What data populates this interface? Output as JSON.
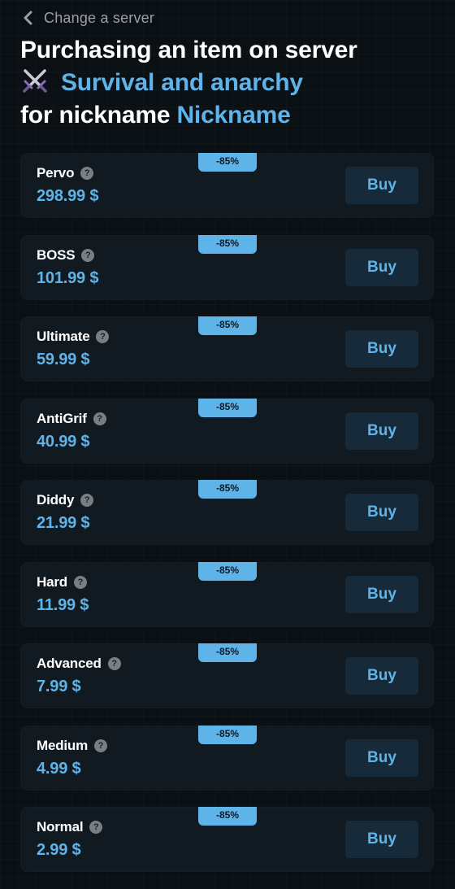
{
  "header": {
    "back_label": "Change a server",
    "title_line1": "Purchasing an item on server",
    "server_name": "Survival and anarchy",
    "server_icon": "crossed-swords-icon",
    "nickname_prefix": "for nickname",
    "nickname": "Nickname"
  },
  "colors": {
    "accent": "#5eb3e8",
    "background": "#0b1015",
    "card": "#111a21",
    "buy_button": "#172a3a"
  },
  "products": [
    {
      "name": "Pervo",
      "price": "298.99 $",
      "discount": "-85%",
      "buy_label": "Buy",
      "help": "?"
    },
    {
      "name": "BOSS",
      "price": "101.99 $",
      "discount": "-85%",
      "buy_label": "Buy",
      "help": "?"
    },
    {
      "name": "Ultimate",
      "price": "59.99 $",
      "discount": "-85%",
      "buy_label": "Buy",
      "help": "?"
    },
    {
      "name": "AntiGrif",
      "price": "40.99 $",
      "discount": "-85%",
      "buy_label": "Buy",
      "help": "?"
    },
    {
      "name": "Diddy",
      "price": "21.99 $",
      "discount": "-85%",
      "buy_label": "Buy",
      "help": "?"
    },
    {
      "name": "Hard",
      "price": "11.99 $",
      "discount": "-85%",
      "buy_label": "Buy",
      "help": "?"
    },
    {
      "name": "Advanced",
      "price": "7.99 $",
      "discount": "-85%",
      "buy_label": "Buy",
      "help": "?"
    },
    {
      "name": "Medium",
      "price": "4.99 $",
      "discount": "-85%",
      "buy_label": "Buy",
      "help": "?"
    },
    {
      "name": "Normal",
      "price": "2.99 $",
      "discount": "-85%",
      "buy_label": "Buy",
      "help": "?"
    }
  ]
}
